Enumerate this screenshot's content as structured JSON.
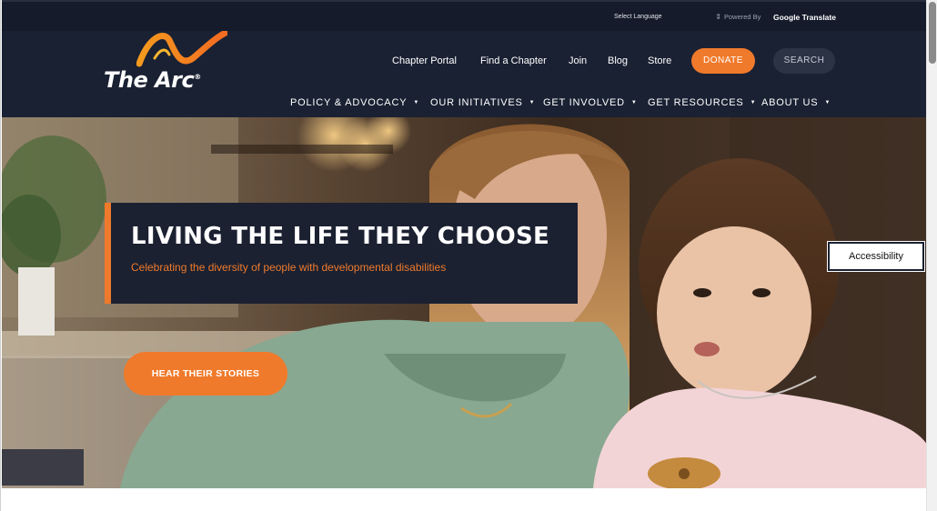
{
  "translate_bar": {
    "select_label": "Select Language",
    "powered_by": "Powered By",
    "provider": "Google Translate"
  },
  "header": {
    "logo_text": "The Arc",
    "logo_mark": "®",
    "util_links": [
      "Chapter Portal",
      "Find a Chapter",
      "Join",
      "Blog",
      "Store"
    ],
    "donate_label": "DONATE",
    "search_label": "SEARCH"
  },
  "main_nav": [
    {
      "label": "POLICY & ADVOCACY",
      "icon": "chevron-down-icon"
    },
    {
      "label": "OUR INITIATIVES",
      "icon": "chevron-down-icon"
    },
    {
      "label": "GET INVOLVED",
      "icon": "chevron-down-icon"
    },
    {
      "label": "GET RESOURCES",
      "icon": "chevron-down-icon"
    },
    {
      "label": "ABOUT US",
      "icon": "chevron-down-icon"
    }
  ],
  "hero": {
    "title": "LIVING THE LIFE THEY CHOOSE",
    "subtitle": "Celebrating the diversity of people with developmental disabilities",
    "cta_label": "HEAR THEIR STORIES"
  },
  "accessibility_label": "Accessibility",
  "colors": {
    "accent": "#f07a2c",
    "navy": "#1a2133",
    "topbar": "#151b2a"
  }
}
